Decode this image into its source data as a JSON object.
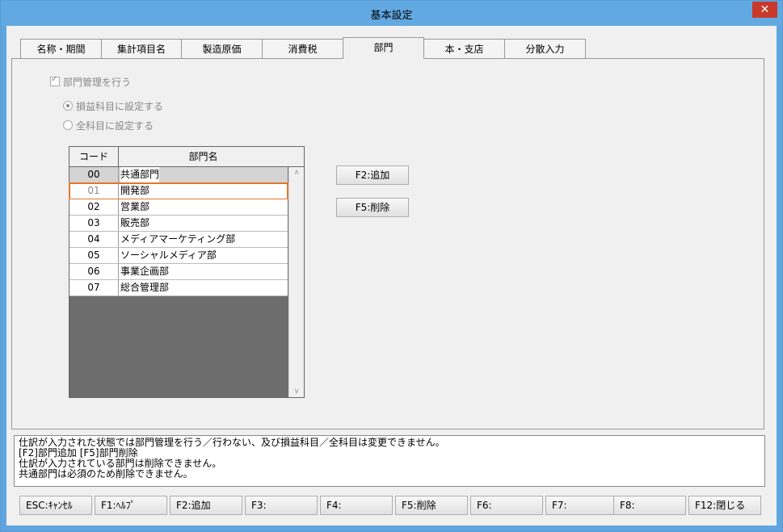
{
  "window": {
    "title": "基本設定",
    "close_label": "✕"
  },
  "tabs": [
    "名称・期間",
    "集計項目名",
    "製造原価",
    "消費税",
    "部門",
    "本・支店",
    "分散入力"
  ],
  "active_tab": "部門",
  "options": {
    "dept_mgmt": "部門管理を行う",
    "pl_accounts": "損益科目に設定する",
    "all_accounts": "全科目に設定する"
  },
  "grid": {
    "headers": {
      "code": "コード",
      "name": "部門名"
    },
    "rows": [
      {
        "code": "00",
        "name": "共通部門"
      },
      {
        "code": "01",
        "name": "開発部"
      },
      {
        "code": "02",
        "name": "営業部"
      },
      {
        "code": "03",
        "name": "販売部"
      },
      {
        "code": "04",
        "name": "メディアマーケティング部"
      },
      {
        "code": "05",
        "name": "ソーシャルメディア部"
      },
      {
        "code": "06",
        "name": "事業企画部"
      },
      {
        "code": "07",
        "name": "総合管理部"
      }
    ],
    "selected_code": "01"
  },
  "buttons": {
    "add": "F2:追加",
    "delete": "F5:削除"
  },
  "messages": [
    "仕訳が入力された状態では部門管理を行う／行わない、及び損益科目／全科目は変更できません。",
    "[F2]部門追加 [F5]部門削除",
    "仕訳が入力されている部門は削除できません。",
    "共通部門は必須のため削除できません。"
  ],
  "function_keys": [
    "ESC:ｷｬﾝｾﾙ",
    "F1:ﾍﾙﾌﾟ",
    "F2:追加",
    "F3:",
    "F4:",
    "F5:削除",
    "F6:",
    "F7:",
    "F8:",
    "F12:閉じる"
  ],
  "colors": {
    "titlebar": "#62a9e2",
    "close": "#c8392b",
    "selection_outline": "#e2762c",
    "grid_bg": "#6d6d6d"
  }
}
